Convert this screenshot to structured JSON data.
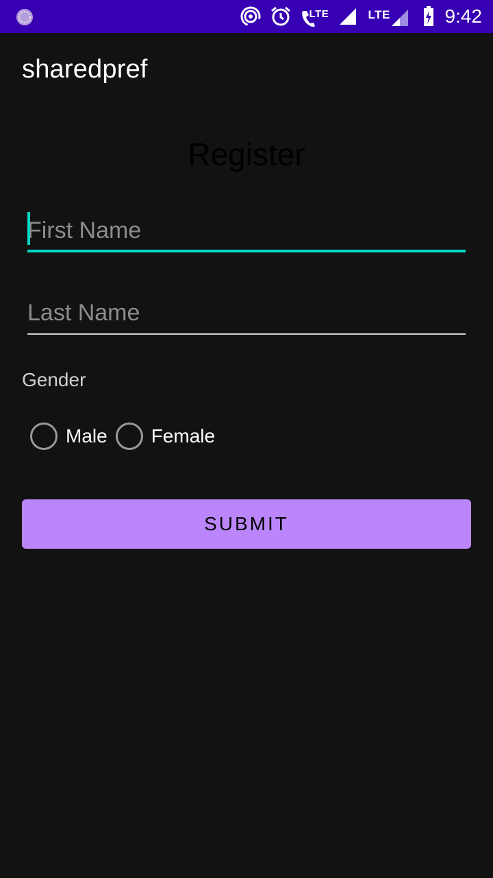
{
  "status_bar": {
    "time": "9:42",
    "lte_1": "LTE",
    "lte_2": "LTE",
    "background_color": "#3700B3",
    "icons": [
      "app-notification-icon",
      "hotspot-icon",
      "alarm-icon",
      "volte-call-icon",
      "signal-icon",
      "signal-icon-2",
      "battery-charging-icon"
    ]
  },
  "app_bar": {
    "title": "sharedpref"
  },
  "form": {
    "heading": "Register",
    "first_name_placeholder": "First Name",
    "last_name_placeholder": "Last Name",
    "gender_label": "Gender",
    "gender_options": [
      "Male",
      "Female"
    ],
    "submit_label": "SUBMIT"
  },
  "colors": {
    "background": "#121212",
    "accent": "#03DAC5",
    "primary": "#BB86FC"
  }
}
